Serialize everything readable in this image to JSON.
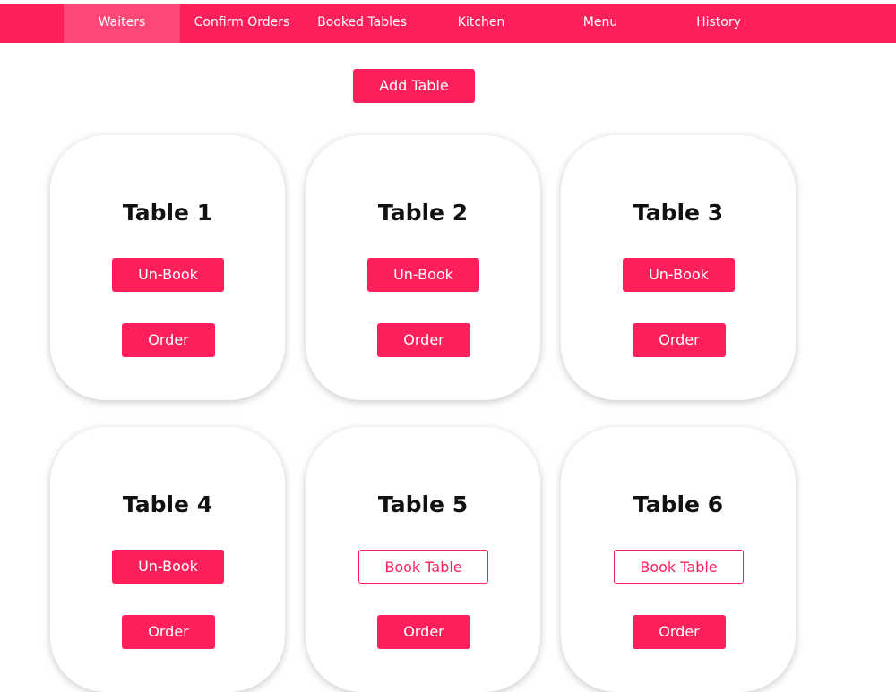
{
  "nav": {
    "items": [
      {
        "label": "Waiters",
        "active": true
      },
      {
        "label": "Confirm Orders",
        "active": false
      },
      {
        "label": "Booked Tables",
        "active": false
      },
      {
        "label": "Kitchen",
        "active": false
      },
      {
        "label": "Menu",
        "active": false
      },
      {
        "label": "History",
        "active": false
      }
    ]
  },
  "toolbar": {
    "add_table_label": "Add Table"
  },
  "tables": [
    {
      "title": "Table 1",
      "book_label": "Un-Book",
      "order_label": "Order",
      "booked": true
    },
    {
      "title": "Table 2",
      "book_label": "Un-Book",
      "order_label": "Order",
      "booked": true
    },
    {
      "title": "Table 3",
      "book_label": "Un-Book",
      "order_label": "Order",
      "booked": true
    },
    {
      "title": "Table 4",
      "book_label": "Un-Book",
      "order_label": "Order",
      "booked": true
    },
    {
      "title": "Table 5",
      "book_label": "Book Table",
      "order_label": "Order",
      "booked": false
    },
    {
      "title": "Table 6",
      "book_label": "Book Table",
      "order_label": "Order",
      "booked": false
    }
  ],
  "colors": {
    "accent": "#ff1f5a",
    "background": "#ffffff",
    "text": "#111111"
  }
}
